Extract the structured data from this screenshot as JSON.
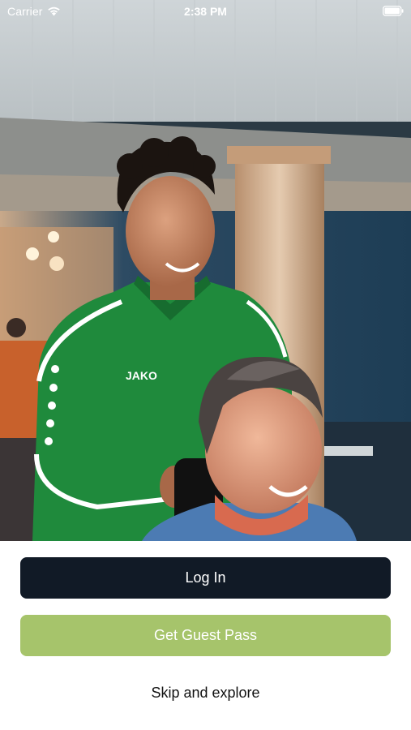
{
  "status_bar": {
    "carrier": "Carrier",
    "time": "2:38 PM",
    "wifi_icon": "wifi-icon",
    "battery_icon": "battery-icon"
  },
  "hero": {
    "photo": "smiling-trainer-and-elderly-woman-photo",
    "jacket_logo": "JAKO"
  },
  "actions": {
    "login_label": "Log In",
    "guest_pass_label": "Get Guest Pass",
    "skip_label": "Skip and explore"
  },
  "colors": {
    "login_button": "#111a26",
    "guest_button": "#a6c46b",
    "background": "#ffffff"
  }
}
